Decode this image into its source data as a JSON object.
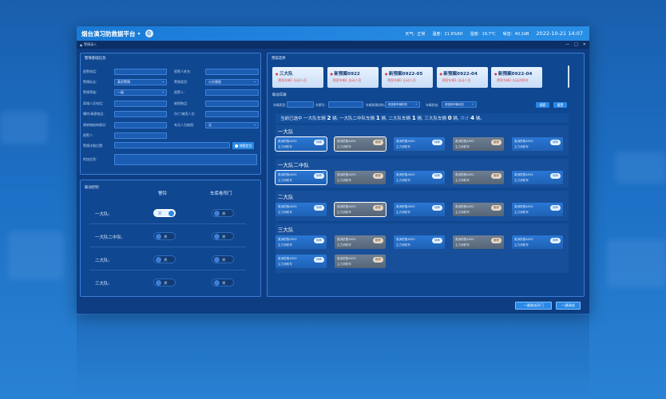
{
  "window": {
    "title": "烟台演习防救据平台",
    "title_suffix": "▾",
    "weather": "天气：正常",
    "temperature": "温度：21.9%RH",
    "humidity": "湿度：19.7°C",
    "noise": "噪音：40.2dB",
    "datetime": "2022-10-21 14:07",
    "subbar_label": "警情录入",
    "win_min": "—",
    "win_max": "□",
    "win_close": "✕"
  },
  "alarm_form": {
    "title": "警情基础信息",
    "fields": [
      {
        "label": "报警电话:",
        "value": ""
      },
      {
        "label": "报警人姓名:",
        "value": ""
      },
      {
        "label": "警情标志:",
        "value": "真实警情"
      },
      {
        "label": "警情类型:",
        "value": "火灾救援"
      },
      {
        "label": "警情等级:",
        "value": "一级"
      },
      {
        "label": "报警人:",
        "value": ""
      },
      {
        "label": "离域人员电话:",
        "value": ""
      },
      {
        "label": "被困物品:",
        "value": ""
      },
      {
        "label": "爆炸/毒害物品:",
        "value": ""
      },
      {
        "label": "伤亡/被困人员:",
        "value": ""
      },
      {
        "label": "建筑物结构情况:",
        "value": ""
      },
      {
        "label": "有无人员被困:",
        "value": "无"
      },
      {
        "label": "报警人:",
        "value": ""
      },
      {
        "label": "警情详细位置:",
        "value": ""
      },
      {
        "label": "附加信息:",
        "value": ""
      }
    ],
    "map_button": "地图定位"
  },
  "linkage": {
    "title": "联动控制",
    "col1": "警铃",
    "col2": "车库卷帘门",
    "rows": [
      {
        "name": "一大队:",
        "bell": "开",
        "door": "关"
      },
      {
        "name": "一大队二中队:",
        "bell": "关",
        "door": "关"
      },
      {
        "name": "二大队:",
        "bell": "关",
        "door": "关"
      },
      {
        "name": "三大队:",
        "bell": "关",
        "door": "关"
      }
    ]
  },
  "plans": {
    "title": "预案选择",
    "cards": [
      {
        "name": "三大队",
        "sub": "预案车辆1  出动人员"
      },
      {
        "name": "新预案0922",
        "sub": "预案车辆1  出动人员"
      },
      {
        "name": "新预案0922-05",
        "sub": "预案车辆1  出动人员"
      },
      {
        "name": "新预案0922-04",
        "sub": "预案车辆1  出动人员"
      },
      {
        "name": "新预案0922-04",
        "sub": "预案车辆1  出动消防车"
      }
    ]
  },
  "dispatch": {
    "title": "联动车辆",
    "filters": [
      {
        "label": "车辆类型:",
        "value": ""
      },
      {
        "label": "车牌号:",
        "value": ""
      },
      {
        "label": "车辆所属机构:",
        "value": "请选择车辆机构"
      },
      {
        "label": "车辆状态:",
        "value": "请选择车辆状态"
      }
    ],
    "search_btn": "搜索",
    "reset_btn": "重置",
    "summary": {
      "prefix": "当前已选中",
      "g1": "一大队车辆",
      "n1": "2",
      "unit": "辆,",
      "g2": "一大队二中队车辆",
      "n2": "1",
      "g3": "二大队车辆",
      "n3": "1",
      "g4": "三大队车辆",
      "n4": "0",
      "total_label": "共计",
      "total": "4",
      "total_unit": "辆。"
    },
    "groups": [
      {
        "name": "一大队",
        "cards": [
          {
            "l1": "英洲防鲁A092",
            "l2": "主力消防车",
            "badge": "待命",
            "gray": false,
            "sel": true
          },
          {
            "l1": "英洲防鲁A092",
            "l2": "主力消防车",
            "badge": "维修",
            "gray": true,
            "sel": true
          },
          {
            "l1": "英洲防鲁A092",
            "l2": "主力消防车",
            "badge": "待命",
            "gray": false,
            "sel": false
          },
          {
            "l1": "英洲防鲁A092",
            "l2": "主力消防车",
            "badge": "维修",
            "gray": true,
            "sel": false
          },
          {
            "l1": "英洲防鲁A092",
            "l2": "主力消防车",
            "badge": "待命",
            "gray": false,
            "sel": false
          }
        ]
      },
      {
        "name": "一大队二中队",
        "cards": [
          {
            "l1": "英洲防鲁A092",
            "l2": "主力消防车",
            "badge": "待命",
            "gray": false,
            "sel": true
          },
          {
            "l1": "英洲防鲁A092",
            "l2": "主力消防车",
            "badge": "维修",
            "gray": true,
            "sel": false
          },
          {
            "l1": "英洲防鲁A092",
            "l2": "主力消防车",
            "badge": "待命",
            "gray": false,
            "sel": false
          },
          {
            "l1": "英洲防鲁A092",
            "l2": "主力消防车",
            "badge": "维修",
            "gray": true,
            "sel": false
          },
          {
            "l1": "英洲防鲁A092",
            "l2": "主力消防车",
            "badge": "待命",
            "gray": false,
            "sel": false
          }
        ]
      },
      {
        "name": "二大队",
        "cards": [
          {
            "l1": "英洲防鲁A092",
            "l2": "主力消防车",
            "badge": "待命",
            "gray": false,
            "sel": false
          },
          {
            "l1": "英洲防鲁A092",
            "l2": "主力消防车",
            "badge": "维修",
            "gray": true,
            "sel": true
          },
          {
            "l1": "英洲防鲁A092",
            "l2": "主力消防车",
            "badge": "待命",
            "gray": false,
            "sel": false
          },
          {
            "l1": "英洲防鲁A092",
            "l2": "主力消防车",
            "badge": "维修",
            "gray": true,
            "sel": false
          },
          {
            "l1": "英洲防鲁A092",
            "l2": "主力消防车",
            "badge": "待命",
            "gray": false,
            "sel": false
          }
        ]
      },
      {
        "name": "三大队",
        "cards": [
          {
            "l1": "英洲防鲁A092",
            "l2": "主力消防车",
            "badge": "待命",
            "gray": false,
            "sel": false
          },
          {
            "l1": "英洲防鲁A092",
            "l2": "主力消防车",
            "badge": "维修",
            "gray": true,
            "sel": false
          },
          {
            "l1": "英洲防鲁A092",
            "l2": "主力消防车",
            "badge": "待命",
            "gray": false,
            "sel": false
          },
          {
            "l1": "英洲防鲁A092",
            "l2": "主力消防车",
            "badge": "维修",
            "gray": true,
            "sel": false
          },
          {
            "l1": "英洲防鲁A092",
            "l2": "主力消防车",
            "badge": "待命",
            "gray": false,
            "sel": false
          },
          {
            "l1": "英洲防鲁A092",
            "l2": "主力消防车",
            "badge": "待命",
            "gray": false,
            "sel": false
          },
          {
            "l1": "英洲防鲁A092",
            "l2": "主力消防车",
            "badge": "维修",
            "gray": true,
            "sel": false
          }
        ]
      }
    ],
    "btn_open_door": "一键调派开门",
    "btn_dispatch": "一键调派"
  }
}
